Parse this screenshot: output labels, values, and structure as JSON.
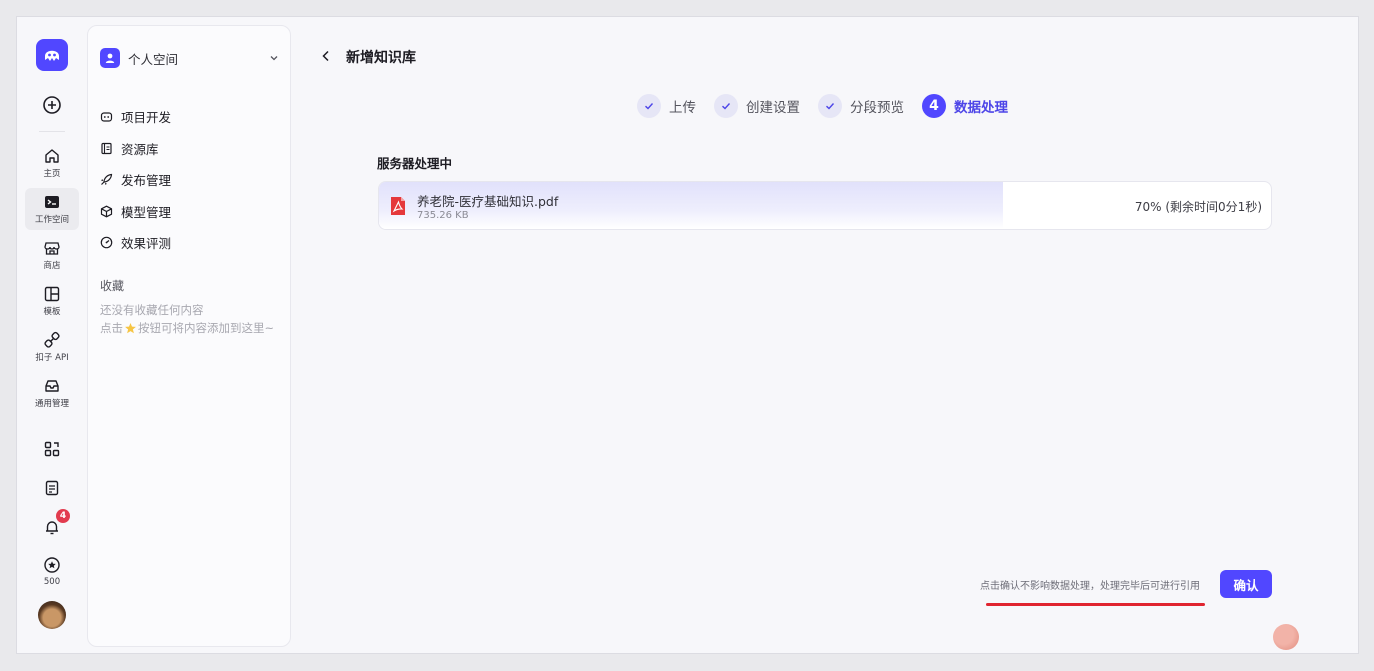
{
  "rail": {
    "items": [
      {
        "label": "主页",
        "icon": "home-icon"
      },
      {
        "label": "工作空间",
        "icon": "terminal-icon"
      },
      {
        "label": "商店",
        "icon": "store-icon"
      },
      {
        "label": "模板",
        "icon": "template-icon"
      },
      {
        "label": "扣子 API",
        "icon": "link-icon"
      },
      {
        "label": "通用管理",
        "icon": "inbox-icon"
      }
    ],
    "notification_count": "4",
    "credits": "500"
  },
  "sidebar": {
    "space_name": "个人空间",
    "menu": [
      {
        "label": "项目开发",
        "icon": "bot-icon"
      },
      {
        "label": "资源库",
        "icon": "library-icon"
      },
      {
        "label": "发布管理",
        "icon": "rocket-icon"
      },
      {
        "label": "模型管理",
        "icon": "cube-icon"
      },
      {
        "label": "效果评测",
        "icon": "gauge-icon"
      }
    ],
    "favorites_title": "收藏",
    "favorites_empty_line1": "还没有收藏任何内容",
    "favorites_empty_line2_a": "点击",
    "favorites_empty_line2_b": "按钮可将内容添加到这里~"
  },
  "main": {
    "title": "新增知识库",
    "steps": [
      {
        "label": "上传",
        "status": "done"
      },
      {
        "label": "创建设置",
        "status": "done"
      },
      {
        "label": "分段预览",
        "status": "done"
      },
      {
        "label": "数据处理",
        "status": "current",
        "number": "4"
      }
    ],
    "section_label": "服务器处理中",
    "file": {
      "name": "养老院-医疗基础知识.pdf",
      "size": "735.26 KB",
      "progress": 0.7,
      "status": "70% (剩余时间0分1秒)"
    },
    "footer_note": "点击确认不影响数据处理，处理完毕后可进行引用",
    "confirm_label": "确认"
  },
  "colors": {
    "accent": "#5147ff",
    "badge": "#e23b4e",
    "underline": "#e0242f"
  }
}
